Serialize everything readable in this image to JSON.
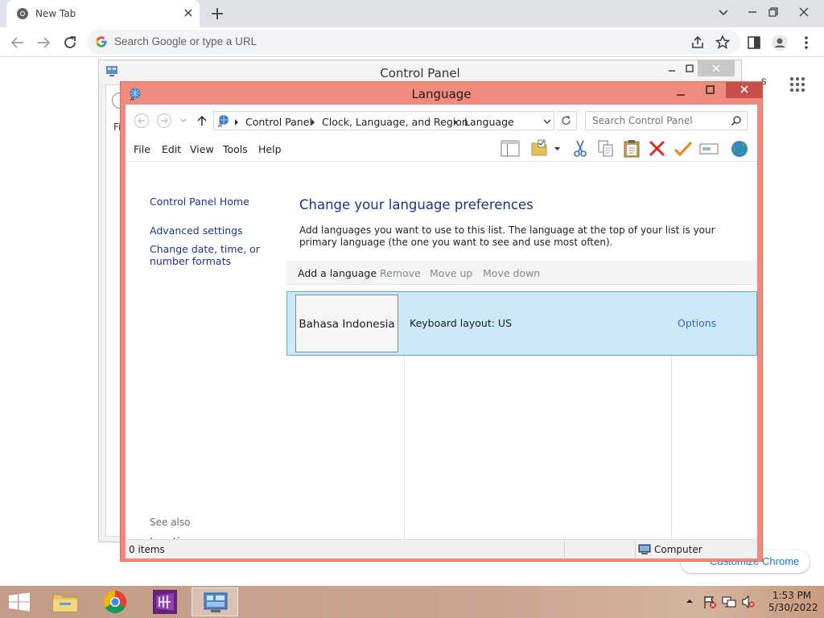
{
  "chrome": {
    "tab_title": "New Tab",
    "omnibox_placeholder": "Search Google or type a URL",
    "background_partial_text": "s",
    "customize_label": "Customize Chrome"
  },
  "bg_window": {
    "title": "Control Panel",
    "partial_menu": "Fi"
  },
  "lang_window": {
    "title": "Language",
    "breadcrumb": [
      "Control Panel",
      "Clock, Language, and Region",
      "Language"
    ],
    "search_placeholder": "Search Control Panel",
    "menu": [
      "File",
      "Edit",
      "View",
      "Tools",
      "Help"
    ],
    "side_nav": {
      "home": "Control Panel Home",
      "advanced": "Advanced settings",
      "change_formats": "Change date, time, or number formats",
      "see_also": "See also",
      "location": "Location"
    },
    "heading": "Change your language preferences",
    "description": "Add languages you want to use to this list. The language at the top of your list is your primary language (the one you want to see and use most often).",
    "commands": {
      "add": "Add a language",
      "remove": "Remove",
      "move_up": "Move up",
      "move_down": "Move down"
    },
    "languages": [
      {
        "name": "Bahasa Indonesia",
        "keyboard": "Keyboard layout: US",
        "options": "Options"
      }
    ],
    "status": {
      "items": "0 items",
      "location": "Computer"
    }
  },
  "taskbar": {
    "time": "1:53 PM",
    "date": "5/30/2022"
  },
  "colors": {
    "lang_frame": "#f08a7c",
    "link_blue": "#1e3287",
    "selection": "#cde8f6",
    "chrome_tabstrip": "#dee1e6"
  }
}
